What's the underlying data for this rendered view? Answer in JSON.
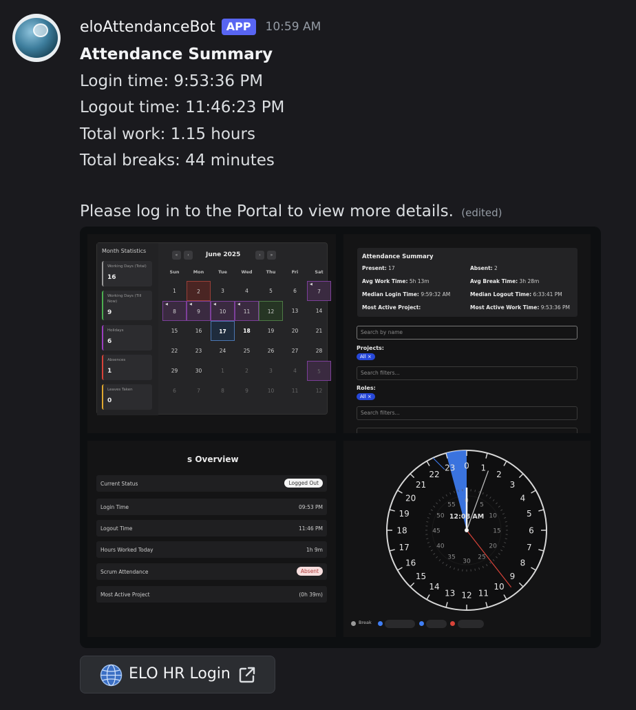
{
  "message": {
    "username": "eloAttendanceBot",
    "badge": "APP",
    "timestamp": "10:59 AM",
    "title": "Attendance Summary",
    "lines": [
      "Login time: 9:53:36 PM",
      "Logout time: 11:46:23 PM",
      "Total work: 1.15 hours",
      "Total breaks: 44 minutes"
    ],
    "portal_note": "Please log in to the Portal to view more details.",
    "edited": "(edited)"
  },
  "calendar": {
    "sidebar_title": "Month Statistics",
    "stats": [
      {
        "label": "Working Days (Total)",
        "value": "16",
        "color": "#9a9a9a"
      },
      {
        "label": "Working Days (Till Now)",
        "value": "9",
        "color": "#4caf50"
      },
      {
        "label": "Holidays",
        "value": "6",
        "color": "#9c3fc1"
      },
      {
        "label": "Absences",
        "value": "1",
        "color": "#d84339"
      },
      {
        "label": "Leaves Taken",
        "value": "0",
        "color": "#e0a82e"
      }
    ],
    "nav": {
      "first": "«",
      "prev": "‹",
      "next": "›",
      "last": "»"
    },
    "month": "June 2025",
    "weekdays": [
      "Sun",
      "Mon",
      "Tue",
      "Wed",
      "Thu",
      "Fri",
      "Sat"
    ],
    "weeks": [
      [
        "1",
        "2",
        "3",
        "4",
        "5",
        "6",
        "7"
      ],
      [
        "8",
        "9",
        "10",
        "11",
        "12",
        "13",
        "14"
      ],
      [
        "15",
        "16",
        "17",
        "18",
        "19",
        "20",
        "21"
      ],
      [
        "22",
        "23",
        "24",
        "25",
        "26",
        "27",
        "28"
      ],
      [
        "29",
        "30",
        "1",
        "2",
        "3",
        "4",
        "5"
      ],
      [
        "6",
        "7",
        "8",
        "9",
        "10",
        "11",
        "12"
      ]
    ],
    "holiday_tag": "◀"
  },
  "summary": {
    "title": "Attendance Summary",
    "present_label": "Present:",
    "present_value": "17",
    "absent_label": "Absent:",
    "absent_value": "2",
    "avg_work_label": "Avg Work Time:",
    "avg_work_value": "5h 13m",
    "avg_break_label": "Avg Break Time:",
    "avg_break_value": "3h 28m",
    "median_login_label": "Median Login Time:",
    "median_login_value": "9:59:32 AM",
    "median_logout_label": "Median Logout Time:",
    "median_logout_value": "6:33:41 PM",
    "most_active_project_label": "Most Active Project:",
    "most_active_work_label": "Most Active Work Time:",
    "most_active_work_value": "9:53:36 PM",
    "search_placeholder": "Search by name",
    "projects_label": "Projects:",
    "projects_chip": "All ×",
    "filters_placeholder": "Search filters...",
    "roles_label": "Roles:",
    "roles_chip": "All ×"
  },
  "overview": {
    "title": "s Overview",
    "rows": [
      {
        "key": "Current Status",
        "value": "Logged Out",
        "type": "pill"
      },
      {
        "key": "Login Time",
        "value": "09:53 PM",
        "type": "text"
      },
      {
        "key": "Logout Time",
        "value": "11:46 PM",
        "type": "text"
      },
      {
        "key": "Hours Worked Today",
        "value": "1h 9m",
        "type": "text"
      },
      {
        "key": "Scrum Attendance",
        "value": "Absent",
        "type": "pill-red"
      },
      {
        "key": "Most Active Project",
        "value": "(0h 39m)",
        "type": "text"
      }
    ]
  },
  "clock": {
    "hours": [
      "0",
      "1",
      "2",
      "3",
      "4",
      "5",
      "6",
      "7",
      "8",
      "9",
      "10",
      "11",
      "12",
      "13",
      "14",
      "15",
      "16",
      "17",
      "18",
      "19",
      "20",
      "21",
      "22",
      "23"
    ],
    "minutes": [
      "0",
      "5",
      "10",
      "15",
      "20",
      "25",
      "30",
      "35",
      "40",
      "45",
      "50",
      "55"
    ],
    "center_label": "12:08 AM",
    "legend_break": "Break",
    "colors": {
      "work": "#3f7ef5",
      "hand": "#e8e8e8",
      "second": "#d84339",
      "break": "#9a9a9a"
    }
  },
  "button": {
    "label": "ELO HR Login"
  }
}
